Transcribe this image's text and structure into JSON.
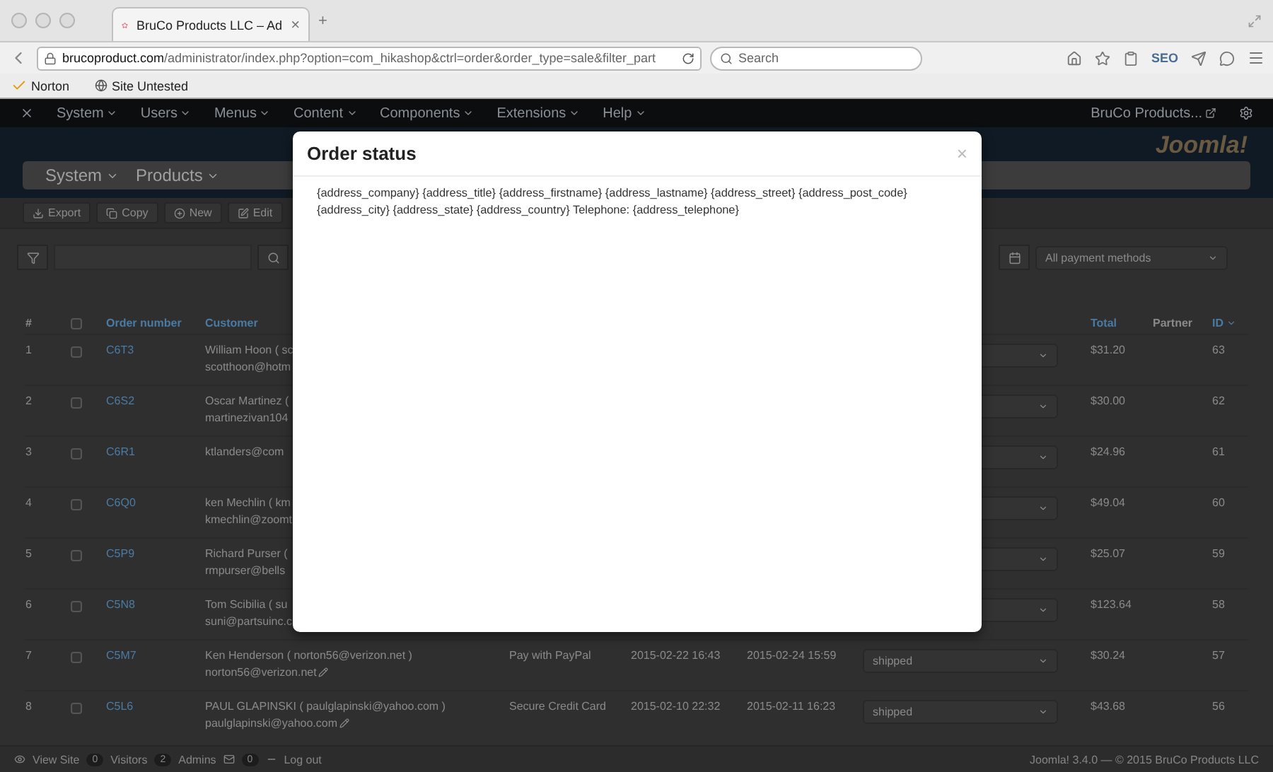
{
  "browser": {
    "tab_title": "BruCo Products LLC – Ad",
    "tab_close": "×",
    "new_tab": "+",
    "url_host": "brucoproduct.com",
    "url_path": "/administrator/index.php?option=com_hikashop&ctrl=order&order_type=sale&filter_part",
    "search_placeholder": "Search",
    "seo_label": "SEO"
  },
  "bookmarks": [
    {
      "label": "Norton",
      "kind": "norton"
    },
    {
      "label": "Site Untested",
      "kind": "site"
    }
  ],
  "admin_menu": {
    "items": [
      "System",
      "Users",
      "Menus",
      "Content",
      "Components",
      "Extensions",
      "Help"
    ],
    "site_link": "BruCo Products..."
  },
  "header": {
    "logo": "Joomla!",
    "menus": [
      "System",
      "Products"
    ]
  },
  "toolbar": [
    {
      "label": "Export",
      "kind": "export"
    },
    {
      "label": "Copy",
      "kind": "copy"
    },
    {
      "label": "New",
      "kind": "new"
    },
    {
      "label": "Edit",
      "kind": "edit"
    }
  ],
  "filter": {
    "payment_select": "All payment methods"
  },
  "table": {
    "select_all_checked": false,
    "columns": [
      {
        "label": "#",
        "kind": "num"
      },
      {
        "label": "Order number",
        "kind": "order"
      },
      {
        "label": "Customer",
        "kind": "customer"
      },
      {
        "label": "Total",
        "kind": "total"
      },
      {
        "label": "Partner",
        "kind": "partner"
      },
      {
        "label": "ID",
        "kind": "id"
      }
    ],
    "rows": [
      {
        "num": "1",
        "checked": false,
        "order": "C6T3",
        "customer": "William Hoon ( sc",
        "email": "scotthoon@hotm",
        "total": "$31.20",
        "id": "63"
      },
      {
        "num": "2",
        "checked": false,
        "order": "C6S2",
        "customer": "Oscar Martinez (",
        "email": "martinezivan104",
        "total": "$30.00",
        "id": "62"
      },
      {
        "num": "3",
        "checked": false,
        "order": "C6R1",
        "customer": "ktlanders@com",
        "total": "$24.96",
        "id": "61"
      },
      {
        "num": "4",
        "checked": false,
        "order": "C6Q0",
        "customer": "ken Mechlin ( km",
        "email": "kmechlin@zoomt",
        "total": "$49.04",
        "id": "60"
      },
      {
        "num": "5",
        "checked": false,
        "order": "C5P9",
        "customer": "Richard Purser (",
        "email": "rmpurser@bells",
        "total": "$25.07",
        "id": "59"
      },
      {
        "num": "6",
        "checked": false,
        "order": "C5N8",
        "customer": "Tom Scibilia ( su",
        "email": "suni@partsuinc.c",
        "total": "$123.64",
        "id": "58"
      },
      {
        "num": "7",
        "checked": false,
        "order": "C5M7",
        "customer": "Ken Henderson ( norton56@verizon.net )",
        "email": "norton56@verizon.net",
        "payment": "Pay with PayPal",
        "created": "2015-02-22 16:43",
        "modified": "2015-02-24 15:59",
        "status": "shipped",
        "total": "$30.24",
        "id": "57"
      },
      {
        "num": "8",
        "checked": false,
        "order": "C5L6",
        "customer": "PAUL GLAPINSKI ( paulglapinski@yahoo.com )",
        "email": "paulglapinski@yahoo.com",
        "payment": "Secure Credit Card",
        "created": "2015-02-10 22:32",
        "modified": "2015-02-11 16:23",
        "status": "shipped",
        "total": "$43.68",
        "id": "56"
      }
    ]
  },
  "status_bar": {
    "view_site": "View Site",
    "visitors_count": "0",
    "visitors": "Visitors",
    "admins_count": "2",
    "admins": "Admins",
    "messages_count": "0",
    "logout": "Log out",
    "copyright": "Joomla! 3.4.0 — © 2015 BruCo Products LLC"
  },
  "modal": {
    "title": "Order status",
    "close": "×",
    "body": "{address_company} {address_title} {address_firstname} {address_lastname} {address_street} {address_post_code} {address_city} {address_state} {address_country} Telephone: {address_telephone}"
  }
}
